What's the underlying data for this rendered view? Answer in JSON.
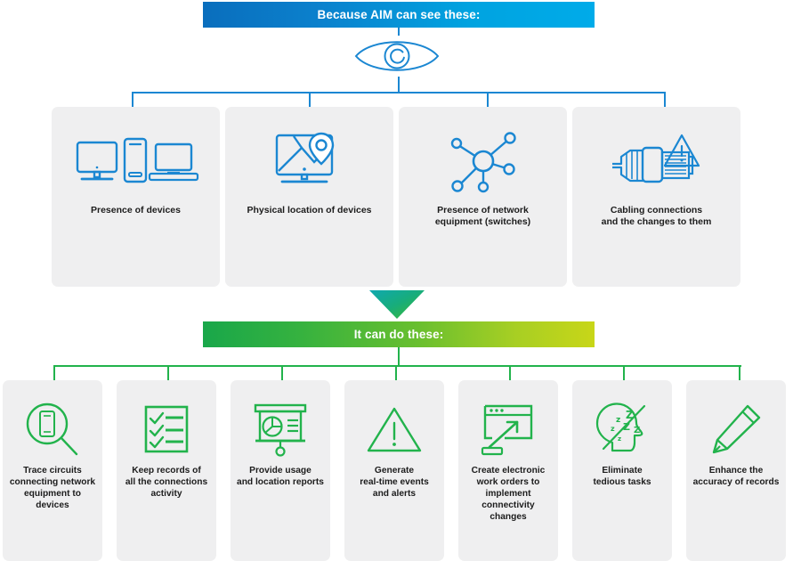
{
  "banners": {
    "top": {
      "text": "Because AIM can see these:",
      "color_from": "#0a6ebd",
      "color_to": "#00abe9"
    },
    "bottom": {
      "text": "It can do these:",
      "color_from": "#19a74a",
      "color_to": "#c8d618"
    }
  },
  "icons": {
    "eye": "eye-icon",
    "arrow": "down-arrow-icon"
  },
  "theme": {
    "blue": "#1b87d2",
    "green": "#22b34c",
    "card_bg": "#efeff0",
    "text": "#1c1c1c"
  },
  "see_section": {
    "cards": [
      {
        "label": "Presence of devices",
        "icon": "devices-icon"
      },
      {
        "label": "Physical location of devices",
        "icon": "map-location-icon"
      },
      {
        "label": "Presence of network\nequipment (switches)",
        "icon": "network-hub-icon"
      },
      {
        "label": "Cabling connections\nand the changes to them",
        "icon": "cable-connector-alert-icon"
      }
    ]
  },
  "do_section": {
    "cards": [
      {
        "label": "Trace circuits\nconnecting network\nequipment to\ndevices",
        "icon": "magnifier-phone-icon"
      },
      {
        "label": "Keep records of\nall the connections\nactivity",
        "icon": "checklist-icon"
      },
      {
        "label": "Provide usage\nand location reports",
        "icon": "presentation-chart-icon"
      },
      {
        "label": "Generate\nreal-time events\nand alerts",
        "icon": "warning-triangle-icon"
      },
      {
        "label": "Create electronic\nwork orders to\nimplement\nconnectivity\nchanges",
        "icon": "browser-upload-icon"
      },
      {
        "label": "Eliminate\ntedious tasks",
        "icon": "no-sleep-head-icon"
      },
      {
        "label": "Enhance the\naccuracy of records",
        "icon": "pencil-icon"
      }
    ]
  }
}
